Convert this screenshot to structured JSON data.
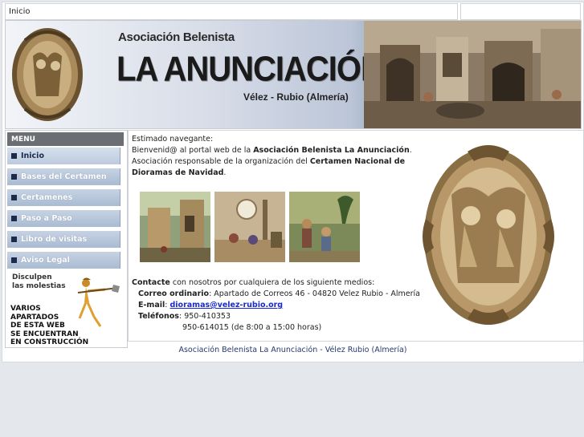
{
  "breadcrumb": {
    "label": "Inicio"
  },
  "banner": {
    "subtitle": "Asociación Belenista",
    "title": "LA ANUNCIACIÓN",
    "location": "Vélez - Rubio (Almería)"
  },
  "menu": {
    "header": "MENU",
    "items": [
      {
        "label": "Inicio"
      },
      {
        "label": "Bases del Certamen"
      },
      {
        "label": "Certamenes"
      },
      {
        "label": "Paso a Paso"
      },
      {
        "label": "Libro de visitas"
      },
      {
        "label": "Aviso Legal"
      }
    ]
  },
  "notice": {
    "line1": "Disculpen",
    "line2": "las molestias",
    "lines": [
      "VARIOS",
      "APARTADOS",
      "DE ESTA WEB",
      "SE ENCUENTRAN",
      "EN CONSTRUCCIÓN"
    ]
  },
  "content": {
    "greeting": "Estimado navegante:",
    "welcome_pre": "Bienvenid@ al portal web de la ",
    "welcome_bold": "Asociación Belenista La Anunciación",
    "welcome_post": ".",
    "resp_pre": "Asociación responsable de la organización del ",
    "resp_bold1": "Certamen Nacional de",
    "resp_bold2": "Dioramas de Navidad",
    "resp_post": ".",
    "contact_bold": "Contacte",
    "contact_rest": " con nosotros por cualquiera de los siguiente medios:",
    "postal_label": "Correo ordinario",
    "postal_value": ": Apartado de Correos 46 - 04820 Velez Rubio - Almería",
    "email_label": "E-mail",
    "email_sep": ": ",
    "email_value": "dioramas@velez-rubio.org",
    "phone_label": "Teléfonos",
    "phone_value1": ": 950-410353",
    "phone_value2": "950-614015 (de 8:00 a 15:00 horas)"
  },
  "footer": {
    "text": "Asociación Belenista La Anunciación - Vélez Rubio (Almería)"
  },
  "colors": {
    "menu_item": "#b4c3d8",
    "menu_header": "#6b6f73",
    "link": "#1a2ad0",
    "footer_text": "#243a6e"
  }
}
